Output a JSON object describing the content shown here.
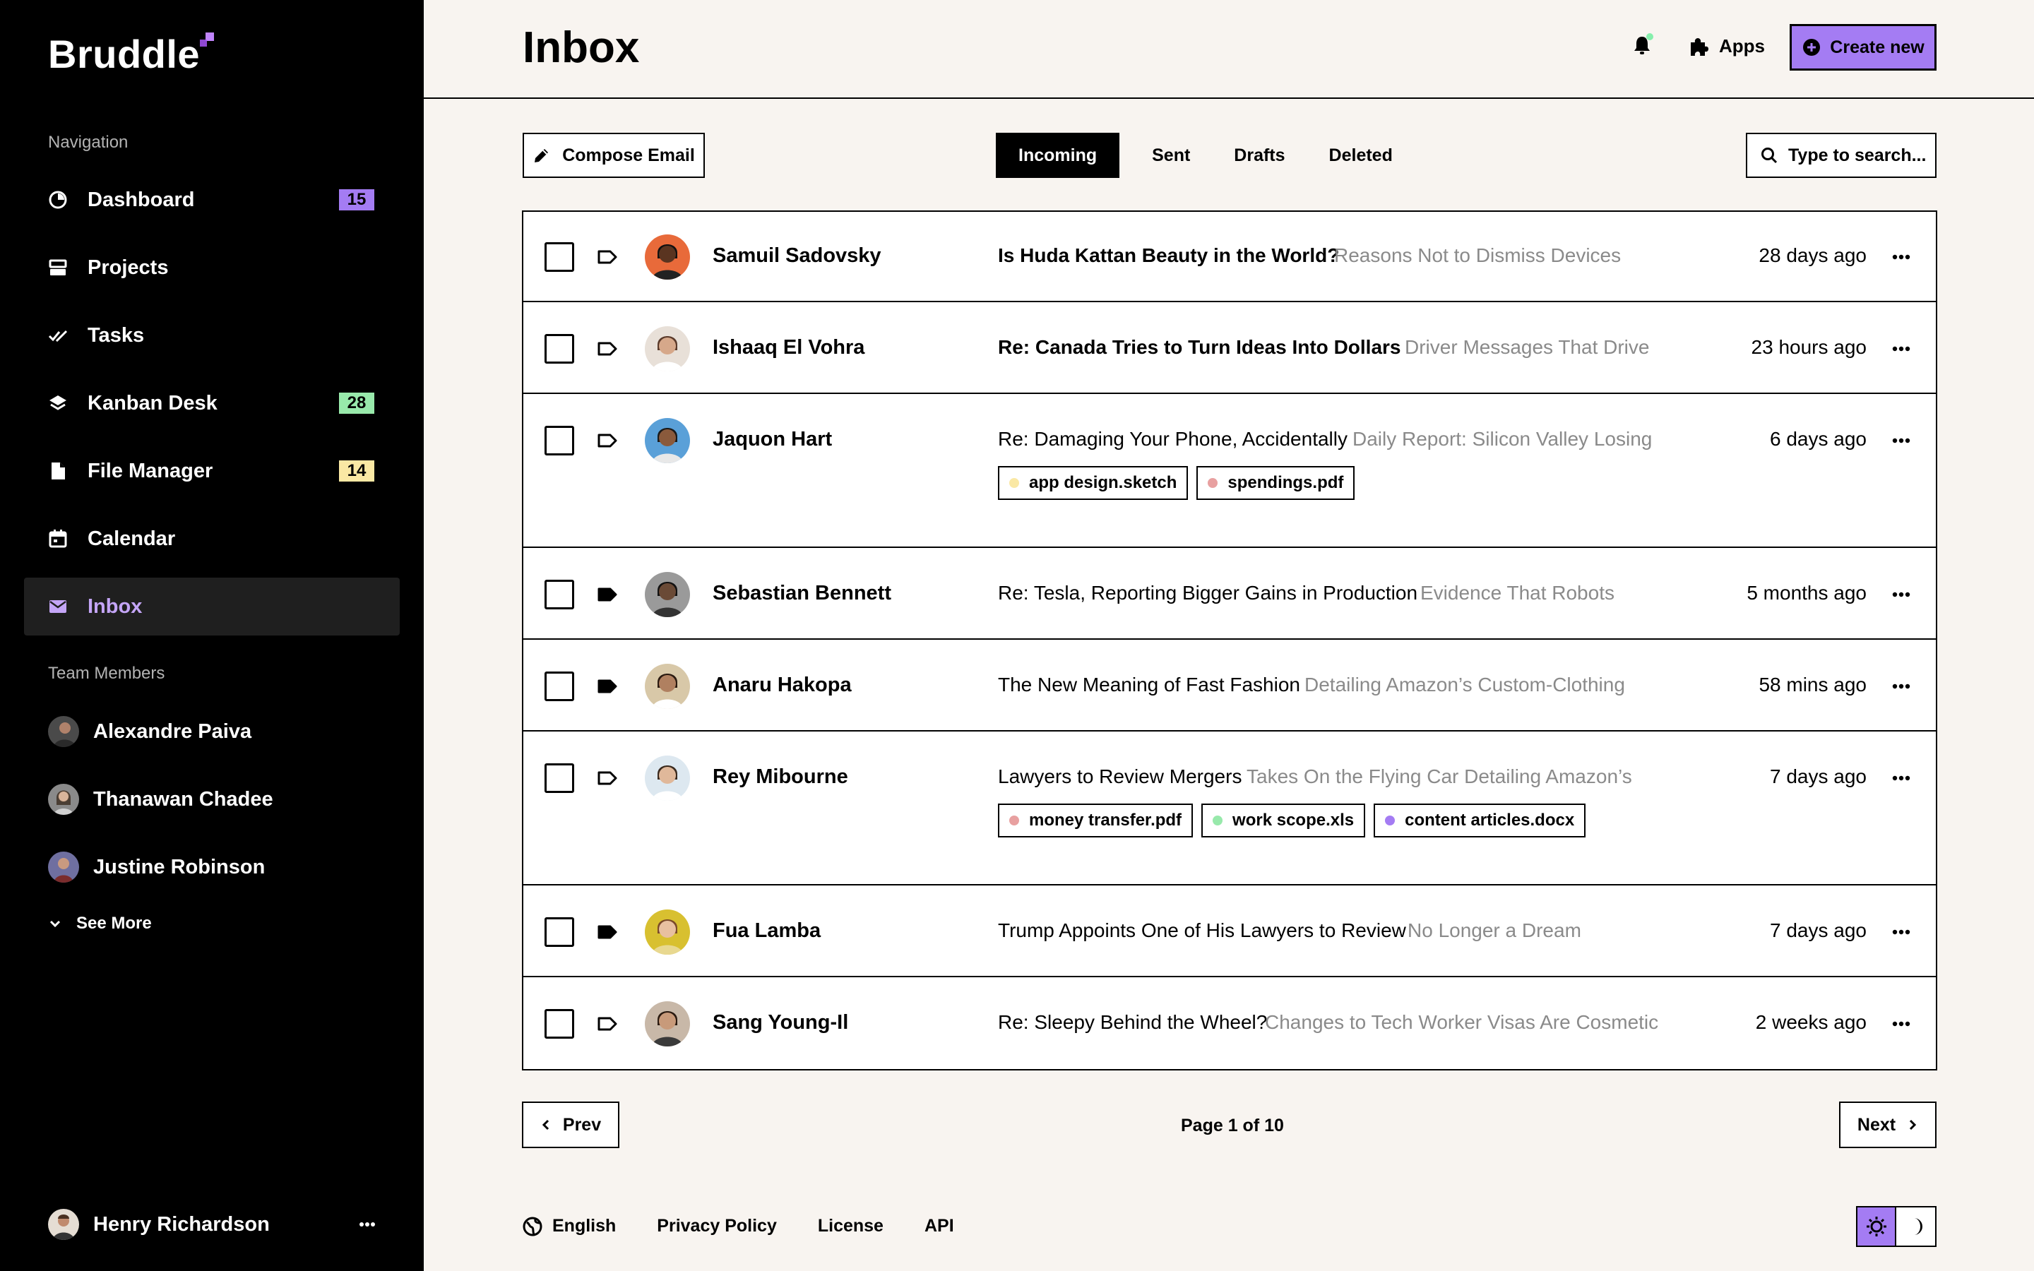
{
  "app": {
    "name": "Bruddle"
  },
  "sidebar": {
    "nav_heading": "Navigation",
    "items": [
      {
        "label": "Dashboard",
        "icon": "dashboard-icon",
        "badge": "15",
        "badge_color": "#a47cf3"
      },
      {
        "label": "Projects",
        "icon": "projects-icon"
      },
      {
        "label": "Tasks",
        "icon": "tasks-icon"
      },
      {
        "label": "Kanban Desk",
        "icon": "kanban-icon",
        "badge": "28",
        "badge_color": "#98e9ab"
      },
      {
        "label": "File Manager",
        "icon": "file-icon",
        "badge": "14",
        "badge_color": "#fae8a4"
      },
      {
        "label": "Calendar",
        "icon": "calendar-icon"
      },
      {
        "label": "Inbox",
        "icon": "mail-icon",
        "active": true
      }
    ],
    "team_heading": "Team Members",
    "members": [
      {
        "name": "Alexandre Paiva"
      },
      {
        "name": "Thanawan Chadee"
      },
      {
        "name": "Justine Robinson"
      }
    ],
    "see_more": "See More",
    "current_user": "Henry Richardson"
  },
  "header": {
    "title": "Inbox",
    "apps_label": "Apps",
    "create_label": "Create new"
  },
  "toolbar": {
    "compose_label": "Compose Email",
    "tabs": [
      "Incoming",
      "Sent",
      "Drafts",
      "Deleted"
    ],
    "active_tab": "Incoming",
    "search_placeholder": "Type to search..."
  },
  "emails": [
    {
      "sender": "Samuil Sadovsky",
      "subject": "Is Huda Kattan Beauty in the World?",
      "preview": "Reasons Not to Dismiss Devices",
      "time": "28 days ago",
      "unread": true,
      "tag_filled": false
    },
    {
      "sender": "Ishaaq El Vohra",
      "subject": "Re: Canada Tries to Turn Ideas Into Dollars",
      "preview": "Driver Messages That Drive",
      "time": "23 hours ago",
      "unread": true,
      "tag_filled": false
    },
    {
      "sender": "Jaquon Hart",
      "subject": "Re: Damaging Your Phone, Accidentally",
      "preview": "Daily Report: Silicon Valley Losing",
      "time": "6 days ago",
      "unread": false,
      "tag_filled": false,
      "attachments": [
        {
          "name": "app design.sketch",
          "color": "#fae8a4"
        },
        {
          "name": "spendings.pdf",
          "color": "#e8a0a0"
        }
      ]
    },
    {
      "sender": "Sebastian Bennett",
      "subject": "Re: Tesla, Reporting Bigger Gains in Production",
      "preview": "Evidence That Robots",
      "time": "5 months ago",
      "unread": false,
      "tag_filled": true
    },
    {
      "sender": "Anaru Hakopa",
      "subject": "The New Meaning of Fast Fashion",
      "preview": "Detailing Amazon’s Custom-Clothing",
      "time": "58 mins ago",
      "unread": false,
      "tag_filled": true
    },
    {
      "sender": "Rey Mibourne",
      "subject": "Lawyers to Review Mergers",
      "preview": "Takes On the Flying Car Detailing Amazon’s",
      "time": "7 days ago",
      "unread": false,
      "tag_filled": false,
      "attachments": [
        {
          "name": "money transfer.pdf",
          "color": "#e8a0a0"
        },
        {
          "name": "work scope.xls",
          "color": "#98e9ab"
        },
        {
          "name": "content articles.docx",
          "color": "#a47cf3"
        }
      ]
    },
    {
      "sender": "Fua Lamba",
      "subject": "Trump Appoints One of His Lawyers to Review",
      "preview": "No Longer a Dream",
      "time": "7 days ago",
      "unread": false,
      "tag_filled": true
    },
    {
      "sender": "Sang Young-Il",
      "subject": "Re: Sleepy Behind the Wheel?",
      "preview": "Changes to Tech Worker Visas Are Cosmetic",
      "time": "2 weeks ago",
      "unread": false,
      "tag_filled": false
    }
  ],
  "pagination": {
    "prev": "Prev",
    "next": "Next",
    "info": "Page 1 of 10"
  },
  "footer": {
    "language": "English",
    "links": [
      "Privacy Policy",
      "License",
      "API"
    ]
  },
  "colors": {
    "accent": "#a47cf3",
    "background": "#f8f4f0",
    "sidebar": "#000000"
  }
}
